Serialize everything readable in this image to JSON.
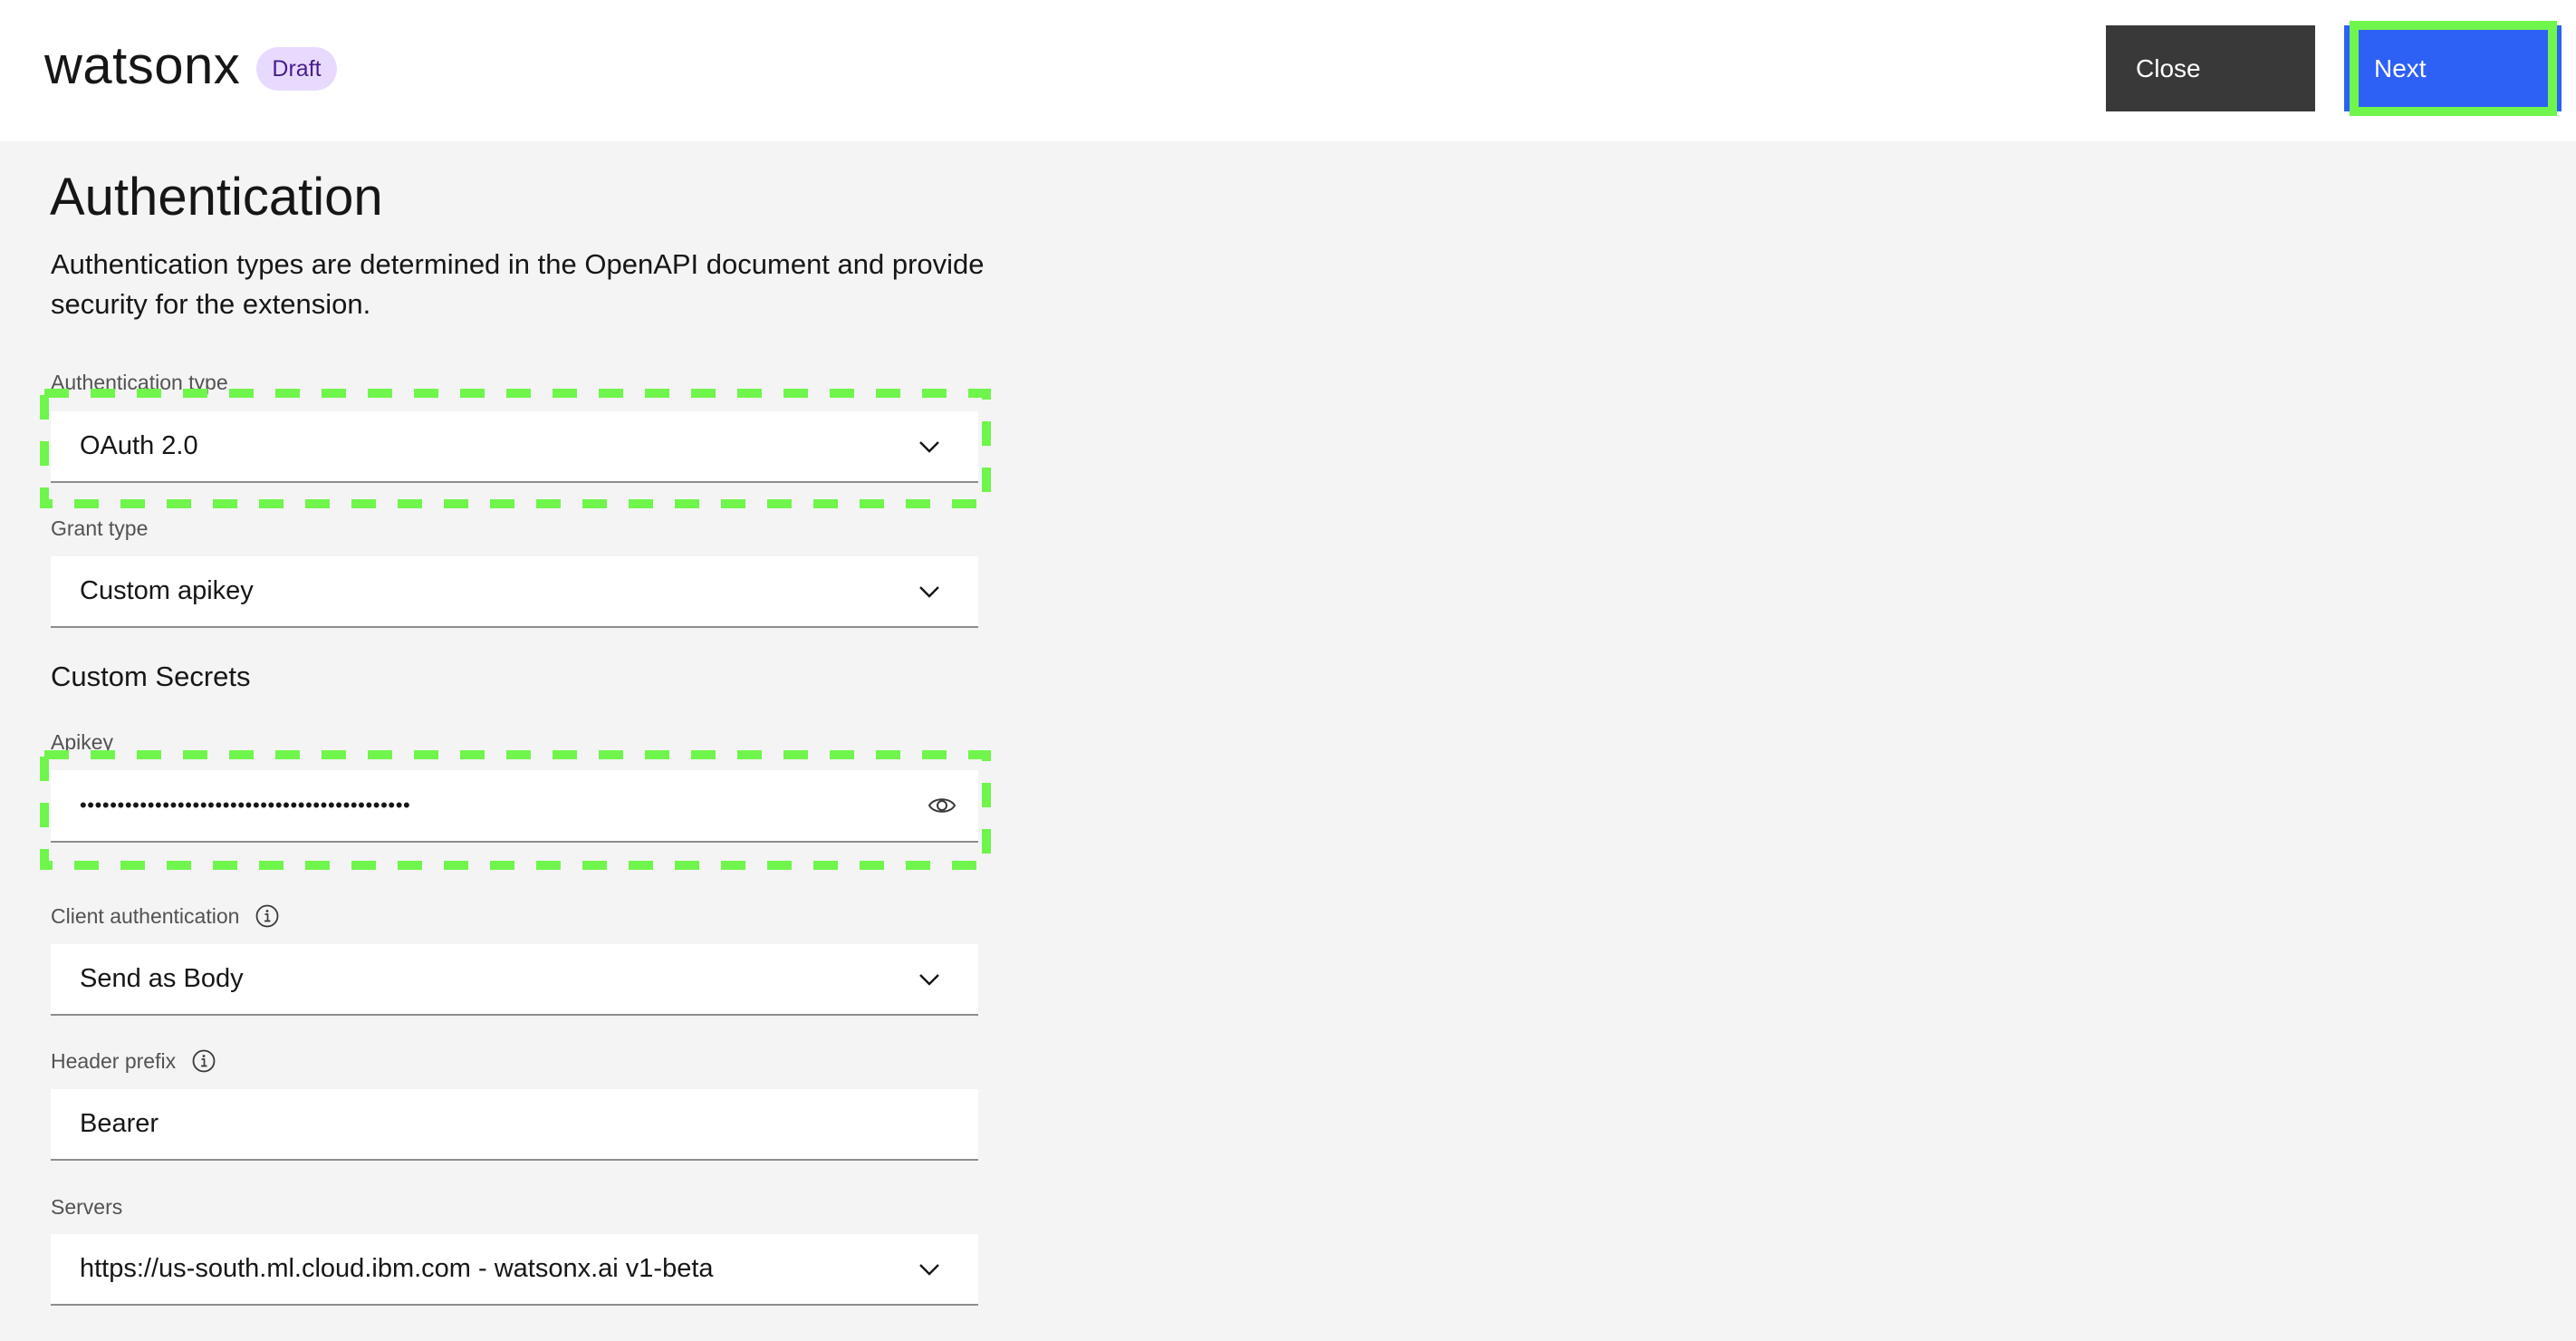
{
  "header": {
    "brand": "watsonx",
    "status_badge": "Draft",
    "close_label": "Close",
    "next_label": "Next"
  },
  "page": {
    "title": "Authentication",
    "description": "Authentication types are determined in the OpenAPI document and provide security for the extension."
  },
  "form": {
    "auth_type": {
      "label": "Authentication type",
      "value": "OAuth 2.0",
      "icon": "chevron-down-icon"
    },
    "grant_type": {
      "label": "Grant type",
      "value": "Custom apikey",
      "icon": "chevron-down-icon"
    },
    "custom_secrets_title": "Custom Secrets",
    "apikey": {
      "label": "Apikey",
      "masked_value": "••••••••••••••••••••••••••••••••••••••••••••",
      "icon": "eye-icon"
    },
    "client_auth": {
      "label": "Client authentication",
      "value": "Send as Body",
      "info_icon": "info-icon",
      "icon": "chevron-down-icon"
    },
    "header_prefix": {
      "label": "Header prefix",
      "value": "Bearer",
      "info_icon": "info-icon"
    },
    "servers": {
      "label": "Servers",
      "value": "https://us-south.ml.cloud.ibm.com - watsonx.ai v1-beta",
      "icon": "chevron-down-icon"
    }
  },
  "colors": {
    "primary_button": "#2d60f5",
    "secondary_button": "#393939",
    "highlight": "#70f54c",
    "badge_bg": "#e8daff",
    "badge_text": "#491d8b",
    "page_bg": "#f4f4f4"
  }
}
